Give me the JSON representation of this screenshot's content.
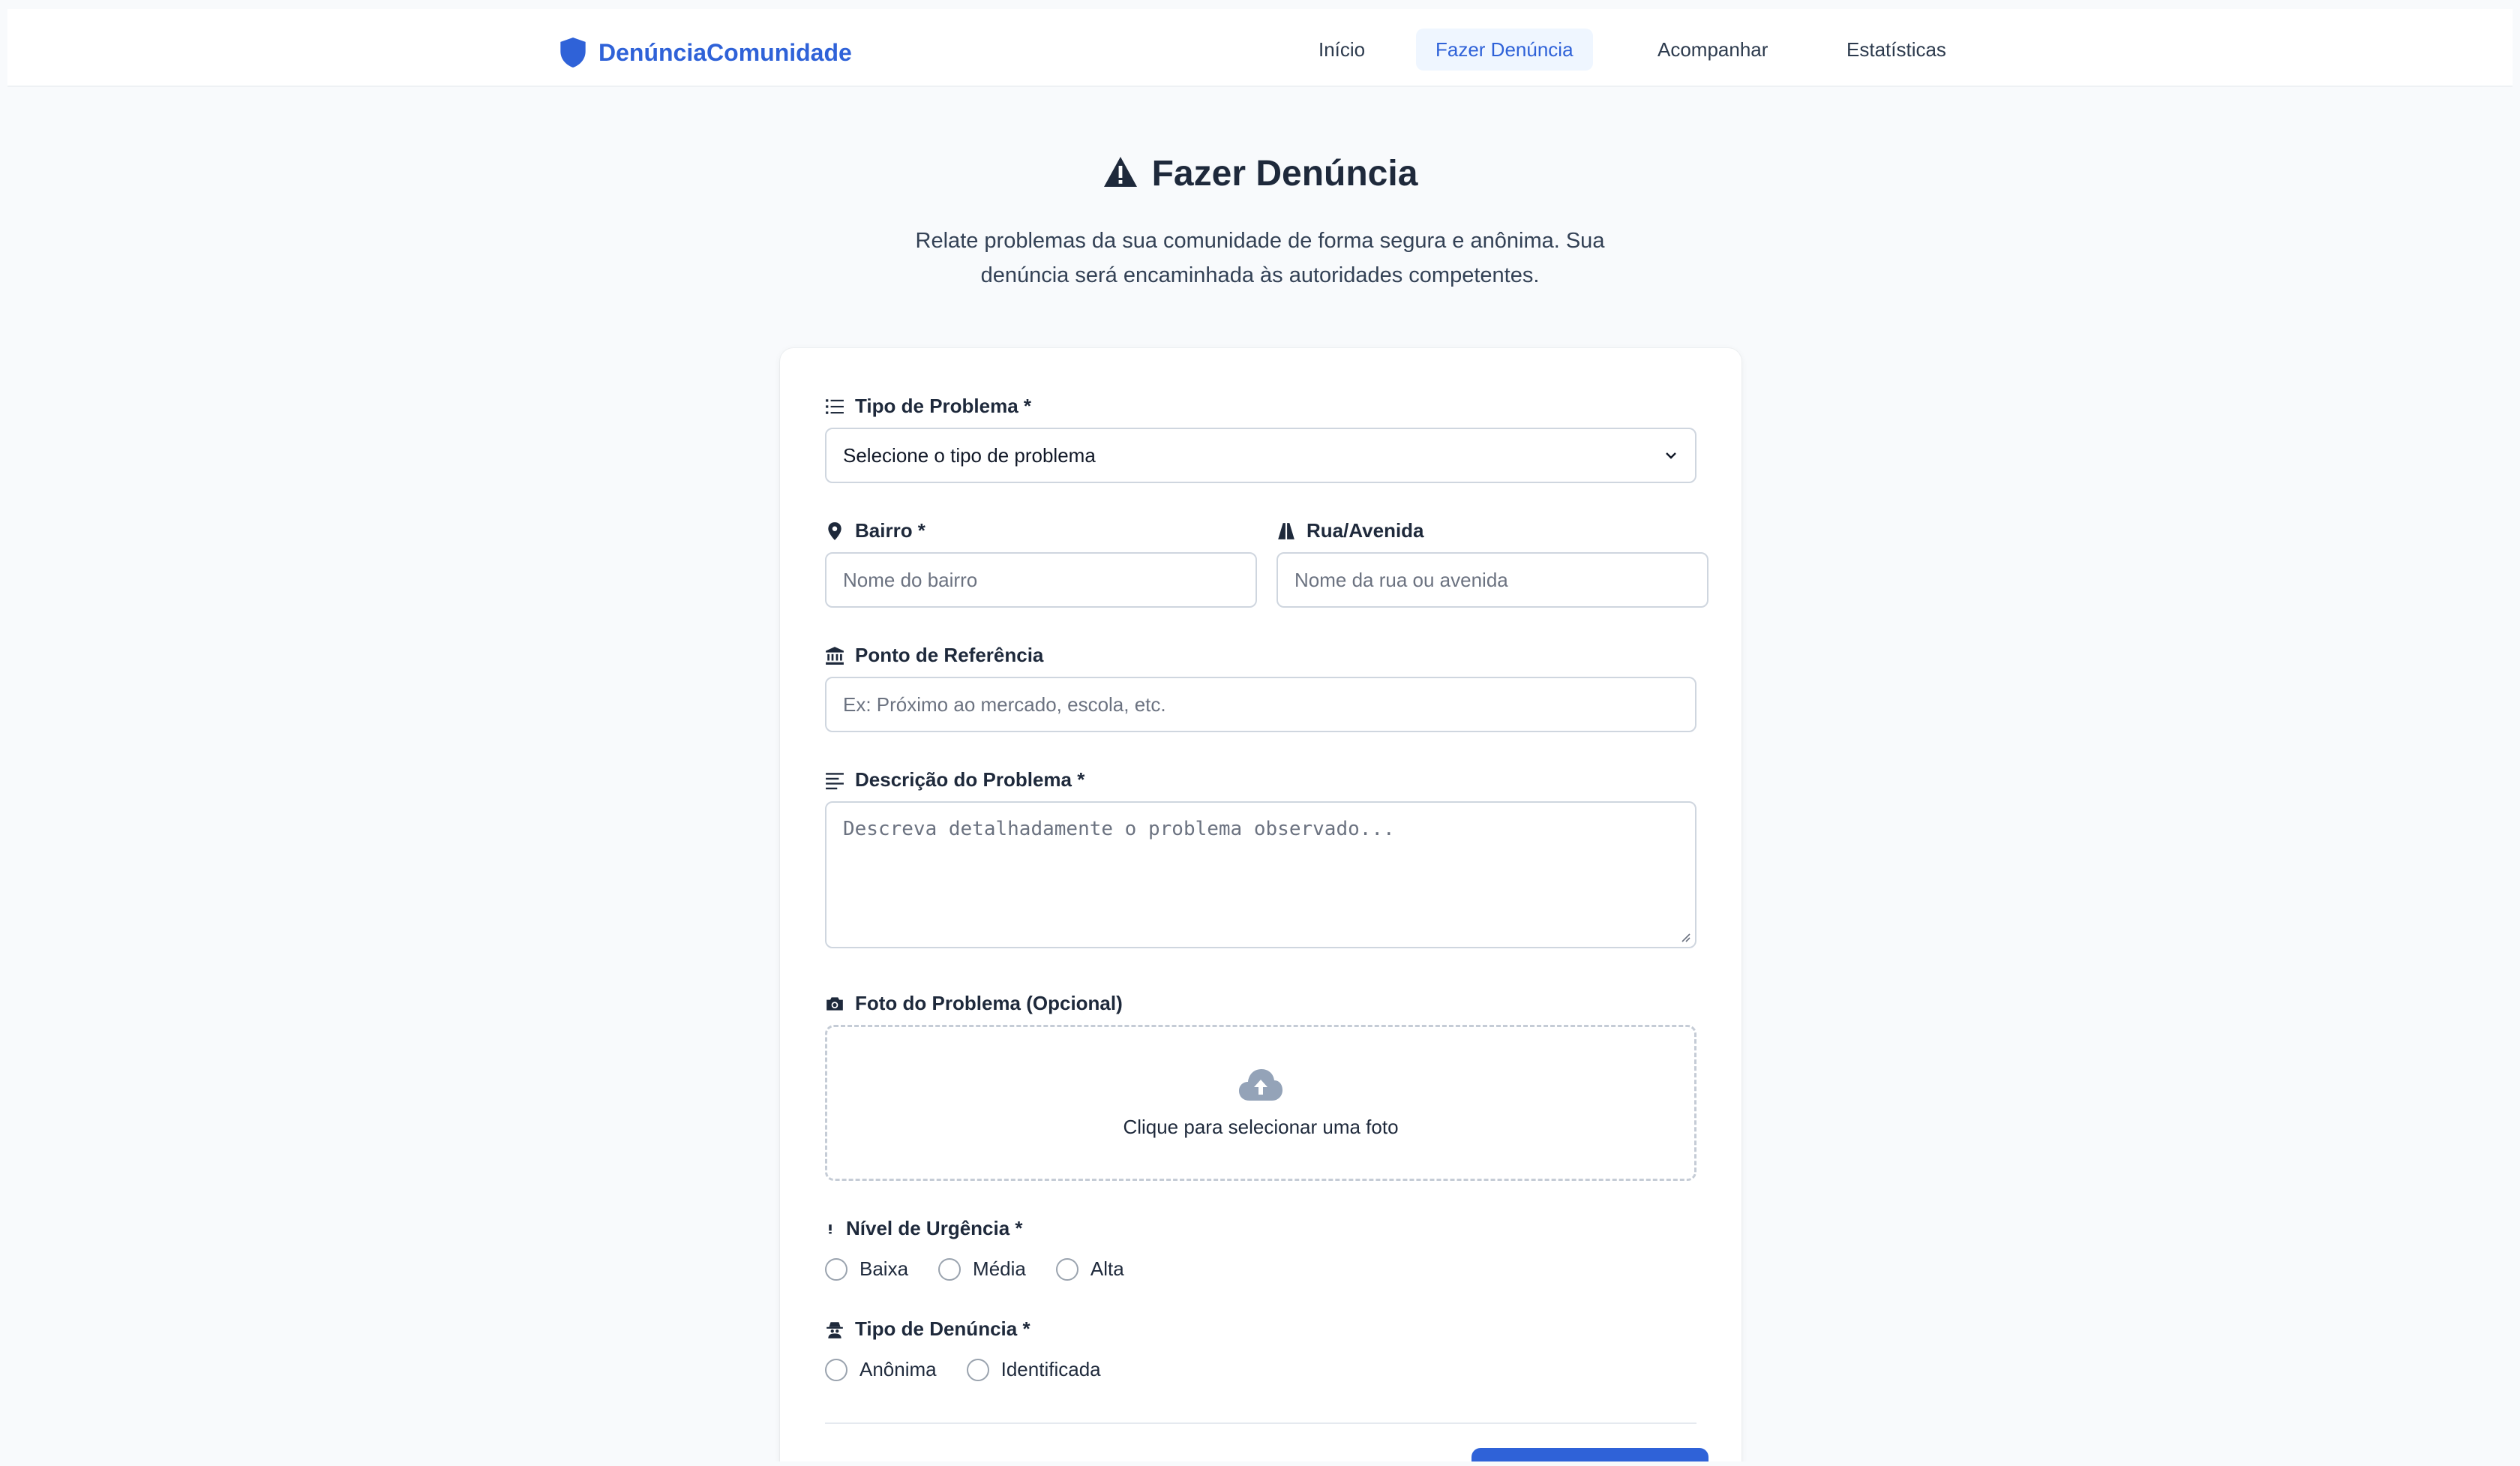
{
  "brand": {
    "name": "DenúnciaComunidade",
    "icon": "shield-icon",
    "color": "#2f62d8"
  },
  "nav": {
    "items": [
      {
        "label": "Início",
        "active": false
      },
      {
        "label": "Fazer Denúncia",
        "active": true
      },
      {
        "label": "Acompanhar",
        "active": false
      },
      {
        "label": "Estatísticas",
        "active": false
      }
    ]
  },
  "hero": {
    "icon": "warning-triangle-icon",
    "title": "Fazer Denúncia",
    "subtitle_line1": "Relate problemas da sua comunidade de forma segura e anônima. Sua",
    "subtitle_line2": "denúncia será encaminhada às autoridades competentes."
  },
  "form": {
    "tipo_problema": {
      "icon": "list-icon",
      "label": "Tipo de Problema *",
      "value": "Selecione o tipo de problema"
    },
    "bairro": {
      "icon": "map-pin-icon",
      "label": "Bairro *",
      "placeholder": "Nome do bairro"
    },
    "rua": {
      "icon": "road-icon",
      "label": "Rua/Avenida",
      "placeholder": "Nome da rua ou avenida"
    },
    "referencia": {
      "icon": "landmark-icon",
      "label": "Ponto de Referência",
      "placeholder": "Ex: Próximo ao mercado, escola, etc."
    },
    "descricao": {
      "icon": "align-left-icon",
      "label": "Descrição do Problema *",
      "placeholder": "Descreva detalhadamente o problema observado..."
    },
    "foto": {
      "icon": "camera-icon",
      "label": "Foto do Problema (Opcional)",
      "upload_icon": "cloud-upload-icon",
      "upload_text": "Clique para selecionar uma foto"
    },
    "urgencia": {
      "icon": "exclamation-icon",
      "label": "Nível de Urgência *",
      "options": [
        "Baixa",
        "Média",
        "Alta"
      ]
    },
    "tipo_denuncia": {
      "icon": "user-secret-icon",
      "label": "Tipo de Denúncia *",
      "options": [
        "Anônima",
        "Identificada"
      ]
    }
  },
  "colors": {
    "accent": "#2f62d8",
    "accent_bg": "#eff6ff",
    "page_bg": "#f8fafc"
  }
}
